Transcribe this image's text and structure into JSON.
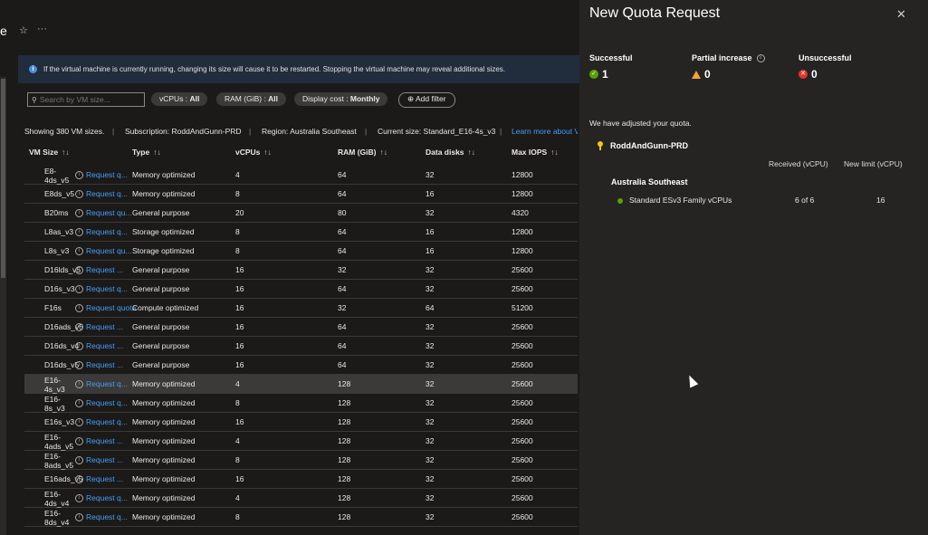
{
  "page": {
    "title_fragment": "e",
    "info_text": "If the virtual machine is currently running, changing its size will cause it to be restarted. Stopping the virtual machine may reveal additional sizes."
  },
  "filters": {
    "search_placeholder": "Search by VM size...",
    "vcpus_key": "vCPUs : ",
    "vcpus_val": "All",
    "ram_key": "RAM (GiB) : ",
    "ram_val": "All",
    "cost_key": "Display cost : ",
    "cost_val": "Monthly",
    "add_filter": "Add filter"
  },
  "meta": {
    "showing": "Showing 380 VM sizes.",
    "subscription": "Subscription: RoddAndGunn-PRD",
    "region": "Region: Australia Southeast",
    "current": "Current size: Standard_E16-4s_v3",
    "learn": "Learn more about V"
  },
  "columns": [
    "VM Size",
    "Type",
    "vCPUs",
    "RAM (GiB)",
    "Data disks",
    "Max IOPS"
  ],
  "rows": [
    {
      "vm": "E8-4ds_v5",
      "rq": "Request q...",
      "type": "Memory optimized",
      "vcpus": "4",
      "ram": "64",
      "disks": "32",
      "iops": "12800"
    },
    {
      "vm": "E8ds_v5",
      "rq": "Request q...",
      "type": "Memory optimized",
      "vcpus": "8",
      "ram": "64",
      "disks": "16",
      "iops": "12800"
    },
    {
      "vm": "B20ms",
      "rq": "Request qu...",
      "type": "General purpose",
      "vcpus": "20",
      "ram": "80",
      "disks": "32",
      "iops": "4320"
    },
    {
      "vm": "L8as_v3",
      "rq": "Request q...",
      "type": "Storage optimized",
      "vcpus": "8",
      "ram": "64",
      "disks": "16",
      "iops": "12800"
    },
    {
      "vm": "L8s_v3",
      "rq": "Request qu...",
      "type": "Storage optimized",
      "vcpus": "8",
      "ram": "64",
      "disks": "16",
      "iops": "12800"
    },
    {
      "vm": "D16lds_v5",
      "rq": "Request ...",
      "type": "General purpose",
      "vcpus": "16",
      "ram": "32",
      "disks": "32",
      "iops": "25600"
    },
    {
      "vm": "D16s_v3",
      "rq": "Request q...",
      "type": "General purpose",
      "vcpus": "16",
      "ram": "64",
      "disks": "32",
      "iops": "25600"
    },
    {
      "vm": "F16s",
      "rq": "Request quota",
      "type": "Compute optimized",
      "vcpus": "16",
      "ram": "32",
      "disks": "64",
      "iops": "51200"
    },
    {
      "vm": "D16ads_v5",
      "rq": "Request ...",
      "type": "General purpose",
      "vcpus": "16",
      "ram": "64",
      "disks": "32",
      "iops": "25600"
    },
    {
      "vm": "D16ds_v4",
      "rq": "Request ...",
      "type": "General purpose",
      "vcpus": "16",
      "ram": "64",
      "disks": "32",
      "iops": "25600"
    },
    {
      "vm": "D16ds_v5",
      "rq": "Request ...",
      "type": "General purpose",
      "vcpus": "16",
      "ram": "64",
      "disks": "32",
      "iops": "25600"
    },
    {
      "vm": "E16-4s_v3",
      "rq": "Request q...",
      "type": "Memory optimized",
      "vcpus": "4",
      "ram": "128",
      "disks": "32",
      "iops": "25600"
    },
    {
      "vm": "E16-8s_v3",
      "rq": "Request q...",
      "type": "Memory optimized",
      "vcpus": "8",
      "ram": "128",
      "disks": "32",
      "iops": "25600"
    },
    {
      "vm": "E16s_v3",
      "rq": "Request q...",
      "type": "Memory optimized",
      "vcpus": "16",
      "ram": "128",
      "disks": "32",
      "iops": "25600"
    },
    {
      "vm": "E16-4ads_v5",
      "rq": "Request ...",
      "type": "Memory optimized",
      "vcpus": "4",
      "ram": "128",
      "disks": "32",
      "iops": "25600"
    },
    {
      "vm": "E16-8ads_v5",
      "rq": "Request ...",
      "type": "Memory optimized",
      "vcpus": "8",
      "ram": "128",
      "disks": "32",
      "iops": "25600"
    },
    {
      "vm": "E16ads_v5",
      "rq": "Request ...",
      "type": "Memory optimized",
      "vcpus": "16",
      "ram": "128",
      "disks": "32",
      "iops": "25600"
    },
    {
      "vm": "E16-4ds_v4",
      "rq": "Request q...",
      "type": "Memory optimized",
      "vcpus": "4",
      "ram": "128",
      "disks": "32",
      "iops": "25600"
    },
    {
      "vm": "E16-8ds_v4",
      "rq": "Request q...",
      "type": "Memory optimized",
      "vcpus": "8",
      "ram": "128",
      "disks": "32",
      "iops": "25600"
    }
  ],
  "panel": {
    "title": "New Quota Request",
    "successful_label": "Successful",
    "successful_count": "1",
    "partial_label": "Partial increase",
    "partial_count": "0",
    "unsuccessful_label": "Unsuccessful",
    "unsuccessful_count": "0",
    "adjusted": "We have adjusted your quota.",
    "subscription": "RoddAndGunn-PRD",
    "col_received": "Received (vCPU)",
    "col_newlimit": "New limit (vCPU)",
    "region": "Australia Southeast",
    "quota_name": "Standard ESv3 Family vCPUs",
    "quota_received": "6 of 6",
    "quota_limit": "16"
  },
  "colors": {
    "accent": "#479ef5",
    "success": "#57a300",
    "warning": "#fc9f3b",
    "error": "#e3352b"
  }
}
